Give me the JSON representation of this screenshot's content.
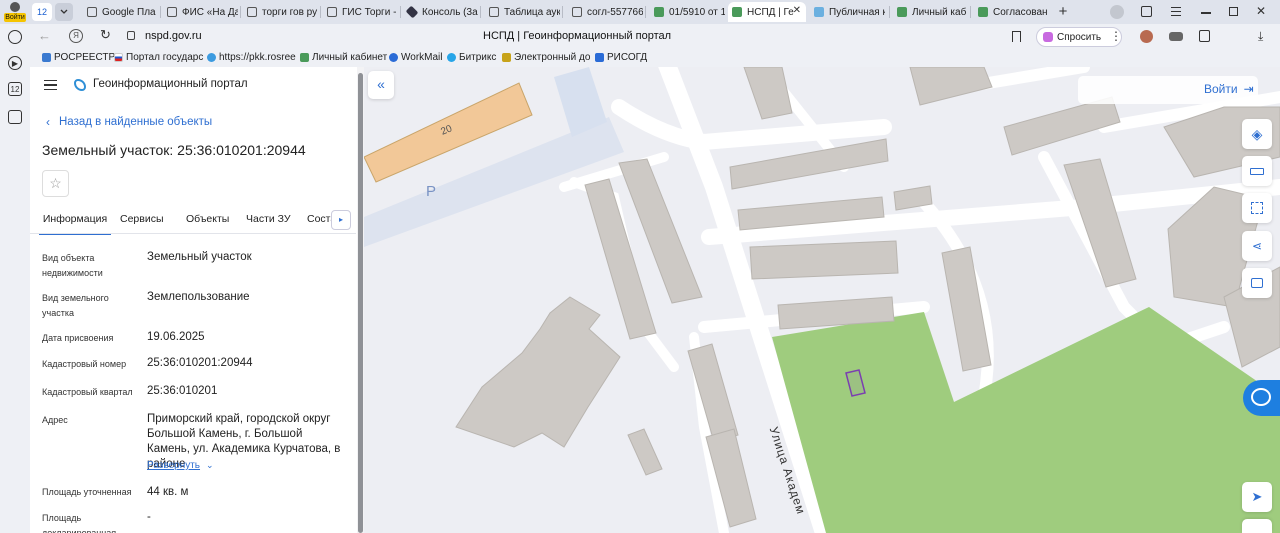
{
  "browser": {
    "profile_label": "Войти",
    "tab_count": "12",
    "tabs": [
      {
        "label": "Google Пла"
      },
      {
        "label": "ФИС «На Да"
      },
      {
        "label": "торги гов ру"
      },
      {
        "label": "ГИС Торги -"
      },
      {
        "label": "Консоль (3а"
      },
      {
        "label": "Таблица аук"
      },
      {
        "label": "согл-557766"
      },
      {
        "label": "01/5910 от 1"
      },
      {
        "label": "НСПД | Ге"
      },
      {
        "label": "Публичная к"
      },
      {
        "label": "Личный каб"
      },
      {
        "label": "Согласован"
      }
    ],
    "address": "nspd.gov.ru",
    "page_title": "НСПД | Геоинформационный портал",
    "ask_label": "Спросить",
    "rail_badge": "12",
    "bookmarks": [
      {
        "label": "РОСРЕЕСТР"
      },
      {
        "label": "Портал государс"
      },
      {
        "label": "https://pkk.rosree"
      },
      {
        "label": "Личный кабинет"
      },
      {
        "label": "WorkMail"
      },
      {
        "label": "Битрикс"
      },
      {
        "label": "Электронный до"
      },
      {
        "label": "РИСОГД"
      }
    ]
  },
  "portal": {
    "title": "Геоинформационный портал",
    "back_link": "Назад в найденные объекты",
    "object_title": "Земельный участок: 25:36:010201:20944",
    "tabs": [
      {
        "label": "Информация"
      },
      {
        "label": "Сервисы"
      },
      {
        "label": "Объекты"
      },
      {
        "label": "Части ЗУ"
      },
      {
        "label": "Соста"
      }
    ],
    "props": [
      {
        "label": "Вид объекта недвижимости",
        "value": "Земельный участок"
      },
      {
        "label": "Вид земельного участка",
        "value": "Землепользование"
      },
      {
        "label": "Дата присвоения",
        "value": "19.06.2025"
      },
      {
        "label": "Кадастровый номер",
        "value": "25:36:010201:20944"
      },
      {
        "label": "Кадастровый квартал",
        "value": "25:36:010201"
      },
      {
        "label": "Адрес",
        "value": "Приморский край, городской округ Большой Камень, г. Большой Камень, ул. Академика Курчатова, в районе"
      },
      {
        "label": "Площадь уточненная",
        "value": "44 кв. м"
      },
      {
        "label": "Площадь декларированная",
        "value": "-"
      }
    ],
    "expand_link": "Развернуть"
  },
  "map": {
    "login_label": "Войти",
    "building_number": "20",
    "parking_label": "P",
    "street_label": "Улица Академ"
  },
  "colors": {
    "accent": "#2f6fd1",
    "park": "#9fcc7e",
    "building": "#cdc9c5",
    "highlight_building": "#f2c898",
    "parcel": "#7b3fb0"
  }
}
